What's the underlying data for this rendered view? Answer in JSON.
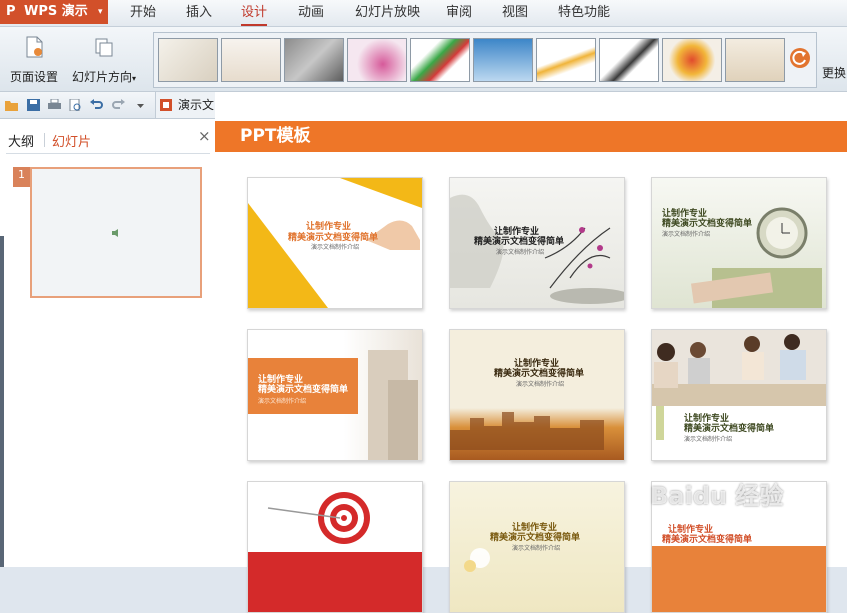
{
  "app": {
    "icon_letter": "P",
    "name": "WPS 演示",
    "dropdown": "▾"
  },
  "menu": [
    "开始",
    "插入",
    "设计",
    "动画",
    "幻灯片放映",
    "审阅",
    "视图",
    "特色功能"
  ],
  "ribbon": {
    "page_setup": "页面设置",
    "orientation": "幻灯片方向",
    "orientation_caret": "▾",
    "change": "更换"
  },
  "doc_tab": "演示文",
  "panel": {
    "tab_outline": "大纲",
    "tab_slides": "幻灯片",
    "close": "×",
    "slide_number": "1"
  },
  "templates": {
    "title": "PPT模板",
    "cards": [
      {
        "l1": "让制作专业",
        "l2": "精美演示文档变得简单",
        "l3": "演示文档制作介绍"
      },
      {
        "l1": "让制作专业",
        "l2": "精美演示文档变得简单",
        "l3": "演示文档制作介绍"
      },
      {
        "l1": "让制作专业",
        "l2": "精美演示文档变得简单",
        "l3": "演示文档制作介绍"
      },
      {
        "l1": "让制作专业",
        "l2": "精美演示文档变得简单",
        "l3": "演示文档制作介绍"
      },
      {
        "l1": "让制作专业",
        "l2": "精美演示文档变得简单",
        "l3": "演示文档制作介绍"
      },
      {
        "l1": "让制作专业",
        "l2": "精美演示文档变得简单",
        "l3": "演示文档制作介绍"
      },
      {
        "l1": "",
        "l2": "",
        "l3": ""
      },
      {
        "l1": "让制作专业",
        "l2": "精美演示文档变得简单",
        "l3": "演示文档制作介绍"
      },
      {
        "l1": "让制作专业",
        "l2": "精美演示文档变得简单",
        "l3": ""
      }
    ]
  },
  "watermark": "Baidu 经验",
  "colors": {
    "accent": "#ee7628",
    "app_red": "#d2502a"
  }
}
